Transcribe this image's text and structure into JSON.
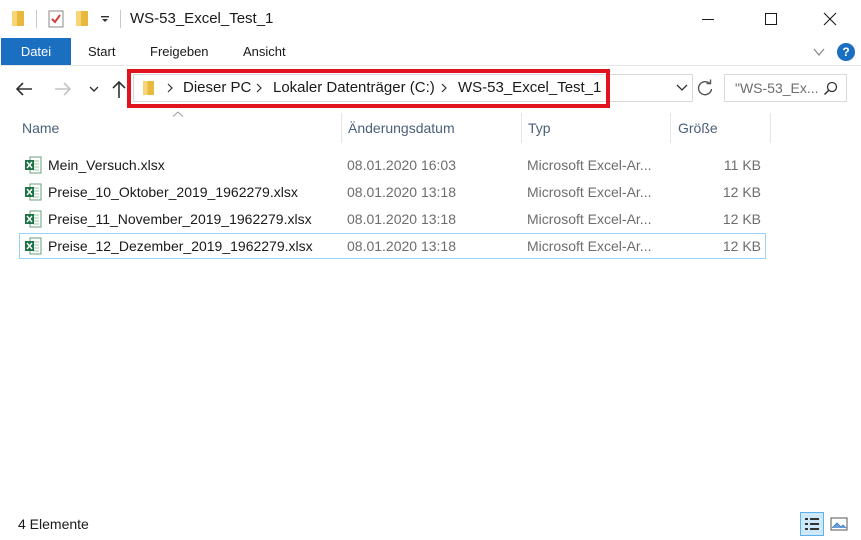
{
  "window": {
    "title": "WS-53_Excel_Test_1"
  },
  "ribbon": {
    "tabs": [
      "Datei",
      "Start",
      "Freigeben",
      "Ansicht"
    ],
    "help": "?"
  },
  "address": {
    "breadcrumbs": [
      "Dieser PC",
      "Lokaler Datenträger (C:)",
      "WS-53_Excel_Test_1"
    ]
  },
  "search": {
    "placeholder": "\"WS-53_Ex..."
  },
  "columns": {
    "name": "Name",
    "date": "Änderungsdatum",
    "type": "Typ",
    "size": "Größe"
  },
  "files": [
    {
      "name": "Mein_Versuch.xlsx",
      "date": "08.01.2020 16:03",
      "type": "Microsoft Excel-Ar...",
      "size": "11 KB"
    },
    {
      "name": "Preise_10_Oktober_2019_1962279.xlsx",
      "date": "08.01.2020 13:18",
      "type": "Microsoft Excel-Ar...",
      "size": "12 KB"
    },
    {
      "name": "Preise_11_November_2019_1962279.xlsx",
      "date": "08.01.2020 13:18",
      "type": "Microsoft Excel-Ar...",
      "size": "12 KB"
    },
    {
      "name": "Preise_12_Dezember_2019_1962279.xlsx",
      "date": "08.01.2020 13:18",
      "type": "Microsoft Excel-Ar...",
      "size": "12 KB"
    }
  ],
  "status": {
    "count": "4 Elemente"
  },
  "colors": {
    "accent": "#1a6fc0",
    "highlight_border": "#e0141e",
    "selection_border": "#99d1ff"
  }
}
